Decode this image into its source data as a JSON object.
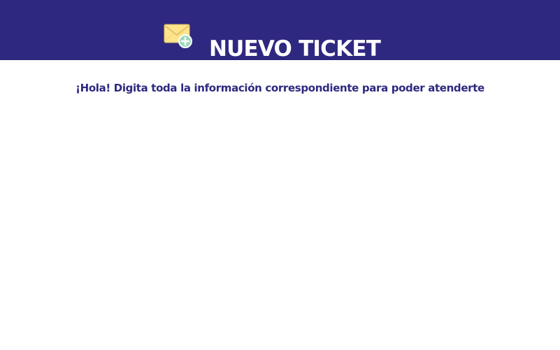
{
  "header": {
    "icon": "new-mail-icon",
    "title": "NUEVO TICKET"
  },
  "main": {
    "intro_text": "¡Hola! Digita toda la información correspondiente para poder atenderte"
  },
  "colors": {
    "header_background": "#2f2880",
    "header_text": "#ffffff",
    "intro_text": "#2f2880",
    "icon_envelope": "#ffe48c",
    "icon_badge": "#9ed9bd"
  }
}
